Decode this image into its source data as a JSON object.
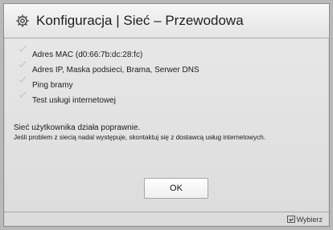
{
  "dialog": {
    "title": "Konfiguracja | Sieć – Przewodowa",
    "check_items": [
      {
        "label": "Adres MAC (d0:66:7b:dc:28:fc)"
      },
      {
        "label": "Adres IP, Maska podsieci, Brama, Serwer DNS"
      },
      {
        "label": "Ping bramy"
      },
      {
        "label": "Test usługi internetowej"
      }
    ],
    "status_message": "Sieć użytkownika działa poprawnie.",
    "help_message": "Jeśli problem z siecią nadal występuje, skontaktuj się z dostawcą usług internetowych.",
    "ok_label": "OK"
  },
  "footer": {
    "select_label": "Wybierz",
    "select_icon": "enter-key-icon"
  },
  "colors": {
    "background": "#b9b9b9",
    "panel": "#e4e4e4",
    "check": "#c8c8c8"
  }
}
